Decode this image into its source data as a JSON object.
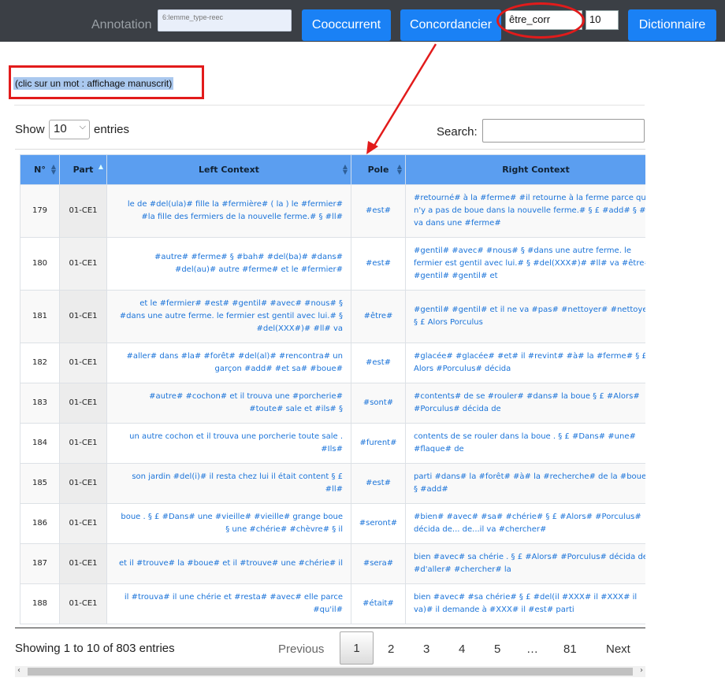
{
  "toolbar": {
    "annotation_label": "Annotation",
    "annotation_value": "6:lemme_type-reec",
    "cooccurrent_label": "Cooccurrent",
    "concordancier_label": "Concordancier",
    "pole_value": "être_corr",
    "count_value": "10",
    "dictionnaire_label": "Dictionnaire"
  },
  "hint": "(clic sur un mot : affichage manuscrit)",
  "length": {
    "show": "Show",
    "selected": "10",
    "entries": "entries"
  },
  "search": {
    "label": "Search:",
    "value": ""
  },
  "table": {
    "headers": [
      "N°",
      "Part",
      "Left Context",
      "Pole",
      "Right Context"
    ],
    "rows": [
      {
        "n": "179",
        "part": "01-CE1",
        "left": "le de #del(ula)# fille la #fermière# ( la ) le #fermier# #la fille des fermiers de la nouvelle ferme.# § #ll#",
        "pole": "#est#",
        "right": "#retourné# à la #ferme# #il retourne à la ferme parce qu'il n'y a pas de boue dans la nouvelle ferme.# § £ #add# § #ll# va dans une #ferme#"
      },
      {
        "n": "180",
        "part": "01-CE1",
        "left": "#autre# #ferme# § #bah# #del(ba)# #dans# #del(au)# autre #ferme# et le #fermier#",
        "pole": "#est#",
        "right": "#gentil# #avec# #nous# § #dans une autre ferme. le fermier est gentil avec lui.# § #del(XXX#)# #ll# va #être# #gentil# #gentil# et"
      },
      {
        "n": "181",
        "part": "01-CE1",
        "left": "et le #fermier# #est# #gentil# #avec# #nous# § #dans une autre ferme. le fermier est gentil avec lui.# § #del(XXX#)# #ll# va",
        "pole": "#être#",
        "right": "#gentil# #gentil# et il ne va #pas# #nettoyer# #nettoyer# § £ Alors Porculus"
      },
      {
        "n": "182",
        "part": "01-CE1",
        "left": "#aller# dans #la# #forêt# #del(al)# #rencontra# un garçon #add# #et sa# #boue#",
        "pole": "#est#",
        "right": "#glacée# #glacée# #et# il #revint# #à# la #ferme# § £ Alors #Porculus# décida"
      },
      {
        "n": "183",
        "part": "01-CE1",
        "left": "#autre# #cochon# et il trouva une #porcherie# #toute# sale et #ils# §",
        "pole": "#sont#",
        "right": "#contents# de se #rouler# #dans# la boue § £ #Alors# #Porculus# décida de"
      },
      {
        "n": "184",
        "part": "01-CE1",
        "left": "un autre cochon et il trouva une porcherie toute sale . #Ils#",
        "pole": "#furent#",
        "right": "contents de se rouler dans la boue . § £ #Dans# #une# #flaque# de"
      },
      {
        "n": "185",
        "part": "01-CE1",
        "left": "son jardin #del(i)# il resta chez lui il était content § £ #ll#",
        "pole": "#est#",
        "right": "parti #dans# la #forêt# #à# la #recherche# de la #boue# § #add#"
      },
      {
        "n": "186",
        "part": "01-CE1",
        "left": "boue . § £ #Dans# une #vieille# #vieille# grange boue § une #chérie# #chèvre# § il",
        "pole": "#seront#",
        "right": "#bien# #avec# #sa# #chérie# § £ #Alors# #Porculus# décida de... de...il va #chercher#"
      },
      {
        "n": "187",
        "part": "01-CE1",
        "left": "et il #trouve# la #boue# et il #trouve# une #chérie# il",
        "pole": "#sera#",
        "right": "bien #avec# sa chérie . § £ #Alors# #Porculus# décida de #d'aller# #chercher# la"
      },
      {
        "n": "188",
        "part": "01-CE1",
        "left": "il #trouva# il une chérie et #resta# #avec# elle parce #qu'il#",
        "pole": "#était#",
        "right": "bien #avec# #sa chérie# § £ #del(il #XXX# il #XXX# il va)# il demande à #XXX# il #est# parti"
      }
    ]
  },
  "footer": {
    "info": "Showing 1 to 10 of 803 entries",
    "previous": "Previous",
    "pages": [
      "1",
      "2",
      "3",
      "4",
      "5",
      "…",
      "81"
    ],
    "next": "Next"
  },
  "scroll": {
    "left_arrow": "‹",
    "right_arrow": "›"
  },
  "colors": {
    "accent": "#1a81f5",
    "annotation_red": "#e21b1b",
    "header_blue": "#5b9ef0",
    "link_blue": "#1a73d9"
  }
}
